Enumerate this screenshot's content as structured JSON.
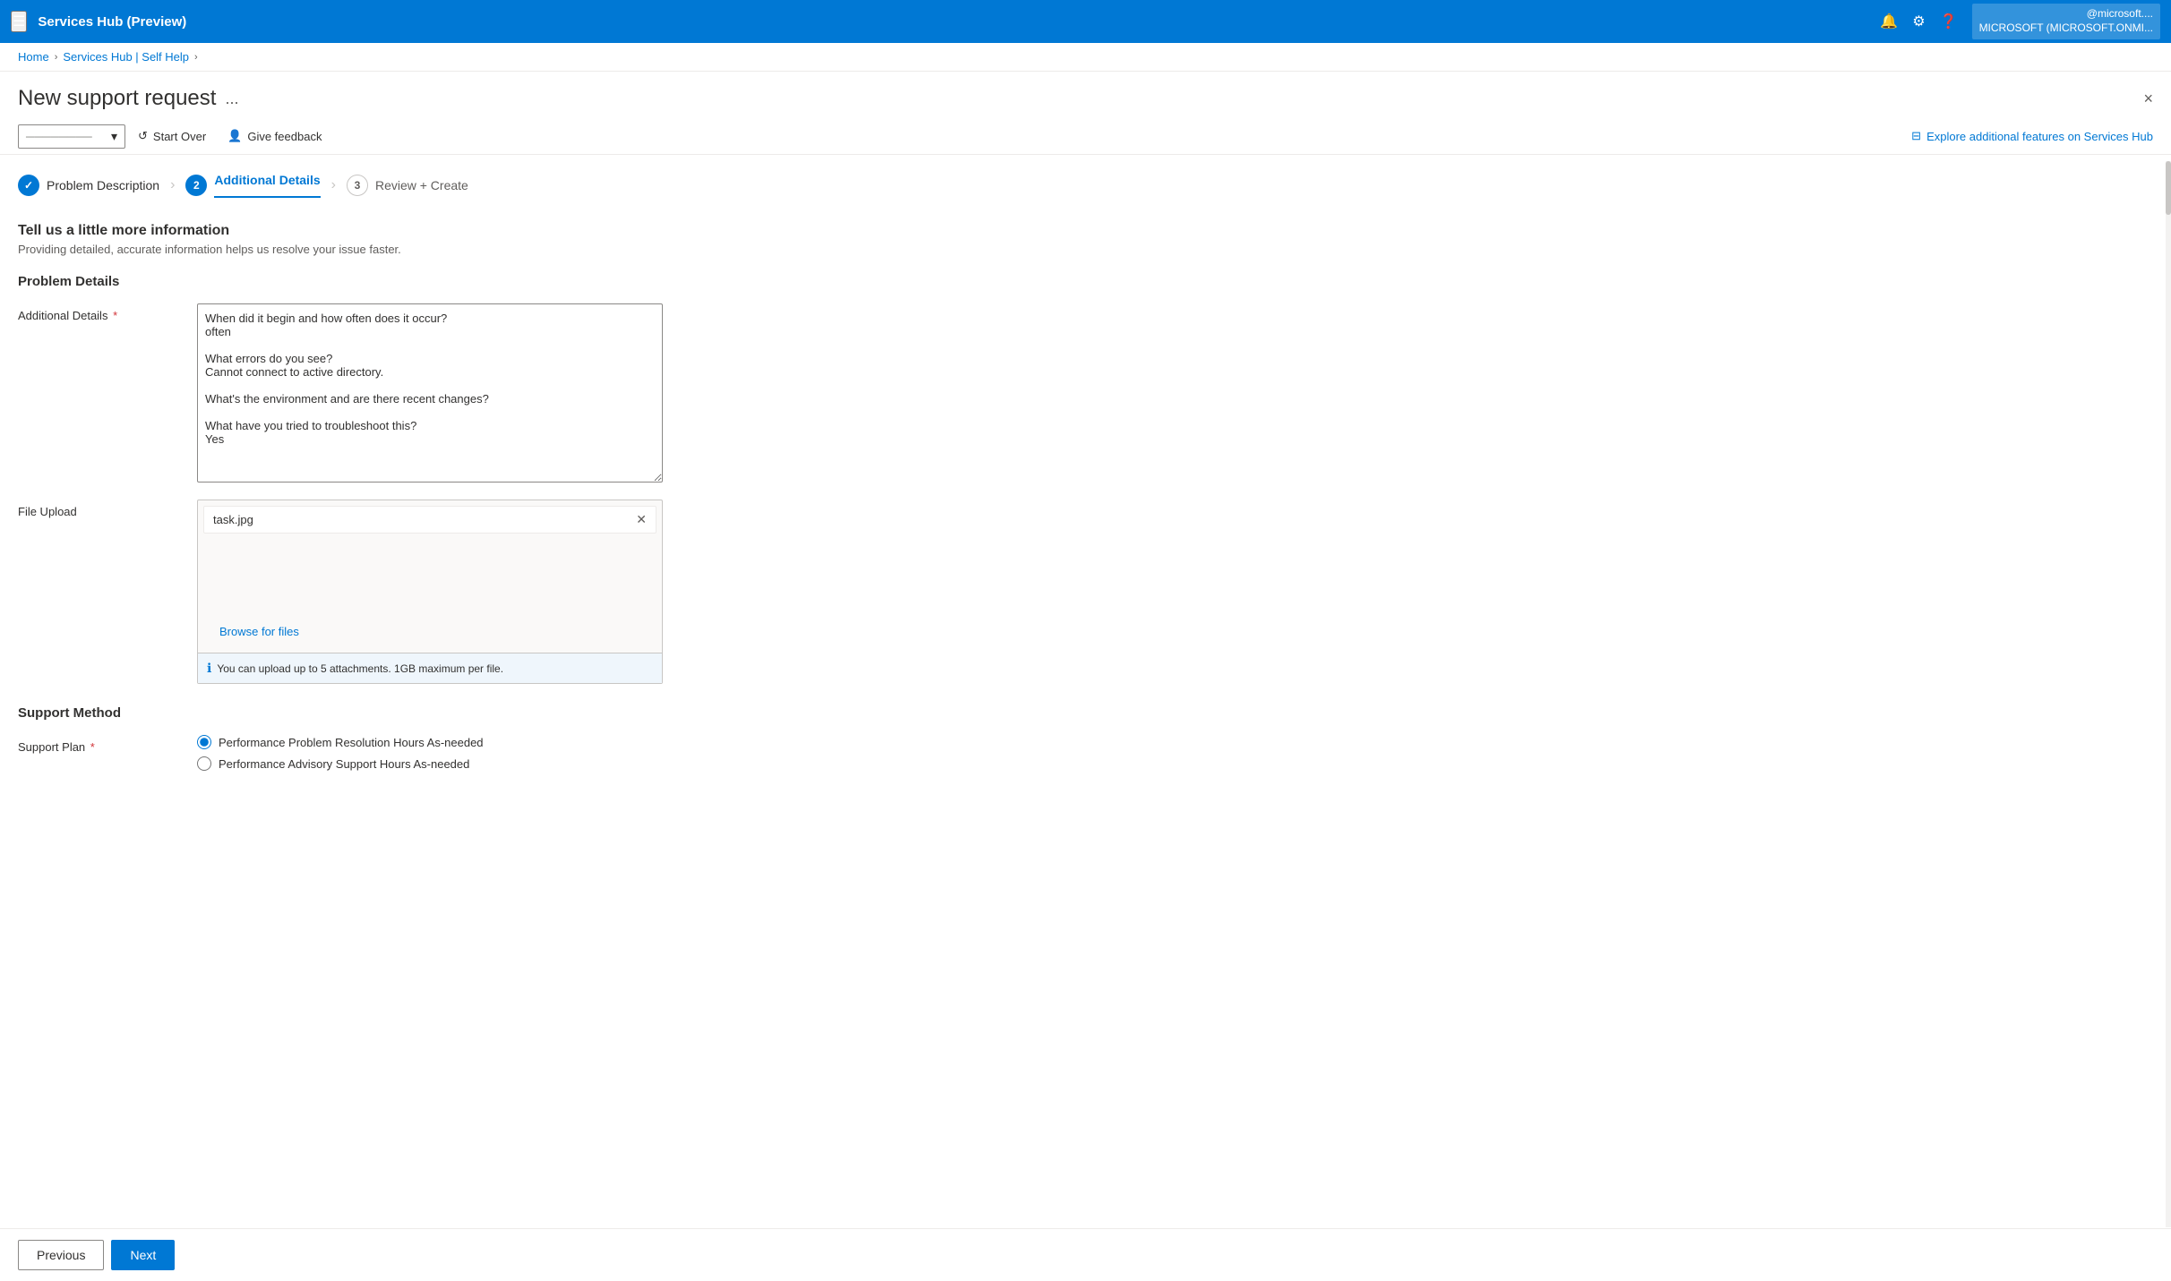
{
  "topbar": {
    "app_title": "Services Hub (Preview)",
    "icons": [
      "bell",
      "gear",
      "help"
    ],
    "user_label": "@microsoft....\nMICROSOFT (MICROSOFT.ONMI..."
  },
  "breadcrumb": {
    "items": [
      "Home",
      "Services Hub | Self Help"
    ],
    "separators": [
      ">",
      ">"
    ]
  },
  "page": {
    "title": "New support request",
    "more_label": "...",
    "close_label": "×"
  },
  "toolbar": {
    "dropdown_placeholder": "──────────────",
    "start_over_label": "Start Over",
    "give_feedback_label": "Give feedback",
    "explore_label": "Explore additional features on Services Hub"
  },
  "steps": [
    {
      "number": "✓",
      "label": "Problem Description",
      "state": "done"
    },
    {
      "number": "2",
      "label": "Additional Details",
      "state": "active"
    },
    {
      "number": "3",
      "label": "Review + Create",
      "state": "inactive"
    }
  ],
  "section": {
    "title": "Tell us a little more information",
    "subtitle": "Providing detailed, accurate information helps us resolve your issue faster."
  },
  "problem_details": {
    "section_title": "Problem Details",
    "additional_details_label": "Additional Details",
    "required": "*",
    "textarea_content": "When did it begin and how often does it occur?\noften\n\nWhat errors do you see?\nCannot connect to active directory.\n\nWhat's the environment and are there recent changes?\n\nWhat have you tried to troubleshoot this?\nYes"
  },
  "file_upload": {
    "label": "File Upload",
    "file_name": "task.jpg",
    "browse_label": "Browse for files",
    "info_text": "You can upload up to 5 attachments. 1GB maximum per file."
  },
  "support_method": {
    "section_title": "Support Method",
    "plan_label": "Support Plan",
    "required": "*",
    "options": [
      {
        "id": "opt1",
        "label": "Performance Problem Resolution Hours As-needed",
        "selected": true
      },
      {
        "id": "opt2",
        "label": "Performance Advisory Support Hours As-needed",
        "selected": false
      }
    ]
  },
  "nav": {
    "previous_label": "Previous",
    "next_label": "Next"
  }
}
